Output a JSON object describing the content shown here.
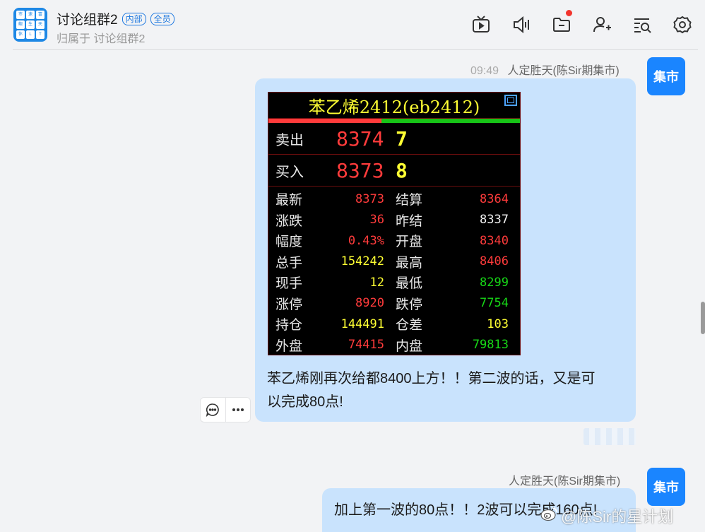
{
  "header": {
    "title": "讨论组群2",
    "badges": [
      "内部",
      "全员"
    ],
    "subtitle": "归属于 讨论组群2",
    "avatar_chars": [
      "市",
      "速",
      "富",
      "鲍",
      "生",
      "天",
      "休",
      "L",
      "T"
    ],
    "tools": [
      "tv-icon",
      "speaker-icon",
      "folder-icon",
      "add-user-icon",
      "search-list-icon",
      "settings-icon"
    ]
  },
  "messages": [
    {
      "time": "09:49",
      "sender": "人定胜天(陈Sir期集市)",
      "avatar_label": "集市",
      "text": "苯乙烯刚再次给都8400上方！！第二波的话，又是可以完成80点!",
      "text_lines": [
        "苯乙烯刚再次给都8400上方！！第二波的话，又是可",
        "以完成80点!"
      ],
      "quote": {
        "title": "苯乙烯2412(eb2412)",
        "sell_label": "卖出",
        "sell_price": "8374",
        "sell_volume": "7",
        "buy_label": "买入",
        "buy_price": "8373",
        "buy_volume": "8",
        "bar_red_fraction": 0.45,
        "rows": [
          {
            "k1": "最新",
            "v1": "8373",
            "c1": "red",
            "k2": "结算",
            "v2": "8364",
            "c2": "red"
          },
          {
            "k1": "涨跌",
            "v1": "36",
            "c1": "red",
            "k2": "昨结",
            "v2": "8337",
            "c2": "white"
          },
          {
            "k1": "幅度",
            "v1": "0.43%",
            "c1": "red",
            "k2": "开盘",
            "v2": "8340",
            "c2": "red"
          },
          {
            "k1": "总手",
            "v1": "154242",
            "c1": "yellow",
            "k2": "最高",
            "v2": "8406",
            "c2": "red"
          },
          {
            "k1": "现手",
            "v1": "12",
            "c1": "yellow",
            "k2": "最低",
            "v2": "8299",
            "c2": "green"
          },
          {
            "k1": "涨停",
            "v1": "8920",
            "c1": "red",
            "k2": "跌停",
            "v2": "7754",
            "c2": "green"
          },
          {
            "k1": "持仓",
            "v1": "144491",
            "c1": "yellow",
            "k2": "仓差",
            "v2": "103",
            "c2": "yellow"
          },
          {
            "k1": "外盘",
            "v1": "74415",
            "c1": "red",
            "k2": "内盘",
            "v2": "79813",
            "c2": "green"
          }
        ]
      }
    },
    {
      "time": "",
      "sender": "人定胜天(陈Sir期集市)",
      "avatar_label": "集市",
      "text": "加上第一波的80点！！2波可以完成160点!"
    }
  ],
  "watermark": "@陈Sir的星计划",
  "colors": {
    "bubble": "#c9e3fd",
    "avatar": "#1a85ff",
    "accent": "#1d78e0",
    "quote_red": "#ff3b3b",
    "quote_green": "#17c417",
    "quote_yellow": "#ffff33"
  }
}
